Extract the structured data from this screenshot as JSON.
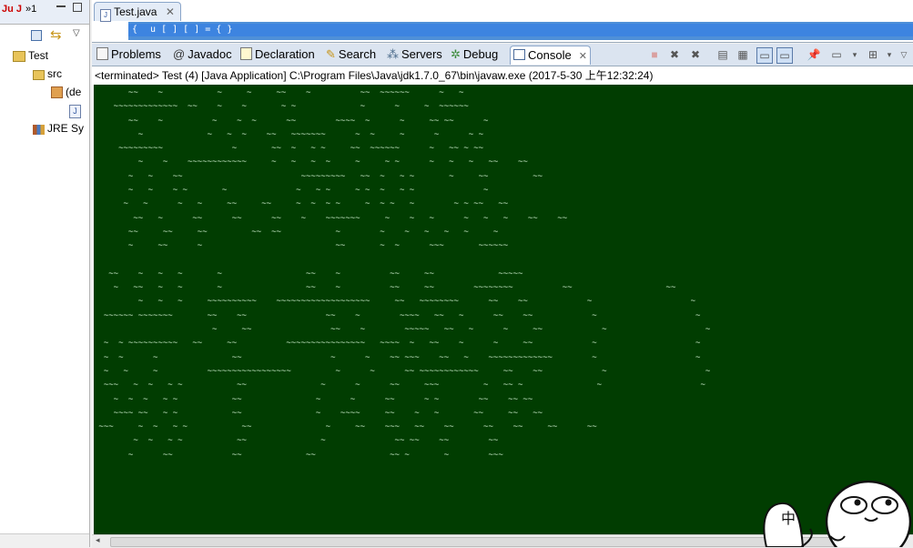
{
  "left_panel": {
    "tabs": [
      "Ju J",
      "»1"
    ],
    "tree": [
      {
        "label": "Test"
      },
      {
        "label": "src"
      },
      {
        "label": "(de"
      },
      {
        "label": "J"
      },
      {
        "label": "JRE Sy"
      }
    ]
  },
  "editor": {
    "tab_label": "Test.java",
    "line1": "{",
    "line2": "  u  [  ]  [  ]  =  {  }"
  },
  "view_tabs": [
    {
      "label": "Problems",
      "icon": "problems-icon"
    },
    {
      "label": "Javadoc",
      "icon": "at-icon"
    },
    {
      "label": "Declaration",
      "icon": "declaration-icon"
    },
    {
      "label": "Search",
      "icon": "search-icon"
    },
    {
      "label": "Servers",
      "icon": "servers-icon"
    },
    {
      "label": "Debug",
      "icon": "debug-icon"
    },
    {
      "label": "Console",
      "icon": "console-icon",
      "active": true
    }
  ],
  "console": {
    "header": "<terminated> Test (4) [Java Application] C:\\Program Files\\Java\\jdk1.7.0_67\\bin\\javaw.exe (2017-5-30 上午12:32:24)",
    "lines": [
      "       ~~    ~           ~     ~     ~~    ~          ~~  ~~~~~~      ~   ~",
      "    ~~~~~~~~~~~~~  ~~    ~    ~       ~ ~             ~      ~     ~  ~~~~~~",
      "       ~~    ~          ~    ~  ~      ~~        ~~~~  ~      ~     ~~ ~~      ~",
      "         ~             ~   ~  ~    ~~   ~~~~~~~      ~  ~     ~      ~      ~ ~",
      "     ~~~~~~~~~              ~       ~~  ~   ~ ~     ~~  ~~~~~~      ~   ~~ ~ ~~",
      "         ~    ~    ~~~~~~~~~~~~     ~   ~   ~  ~     ~     ~ ~      ~   ~   ~   ~~    ~~",
      "       ~   ~    ~~                        ~~~~~~~~~   ~~  ~   ~ ~       ~     ~~         ~~",
      "       ~   ~    ~ ~       ~              ~   ~ ~     ~ ~  ~   ~ ~              ~",
      "      ~   ~      ~   ~     ~~     ~~     ~  ~  ~ ~     ~  ~ ~   ~        ~ ~ ~~   ~~",
      "        ~~   ~      ~~      ~~      ~~    ~    ~~~~~~~     ~    ~   ~      ~   ~   ~    ~~    ~~",
      "       ~~     ~~     ~~         ~~  ~~           ~        ~    ~   ~   ~   ~     ~",
      "       ~     ~~      ~                           ~~       ~  ~      ~~~       ~~~~~~",
      "",
      "   ~~    ~   ~   ~       ~                 ~~    ~          ~~     ~~             ~~~~~",
      "    ~   ~~   ~   ~       ~                 ~~    ~          ~~     ~~        ~~~~~~~~          ~~                   ~~",
      "         ~   ~   ~     ~~~~~~~~~~    ~~~~~~~~~~~~~~~~~~~     ~~   ~~~~~~~~      ~~    ~~            ~                    ~",
      "  ~~~~~~ ~~~~~~~       ~~    ~~                ~~    ~        ~~~~   ~~   ~      ~~    ~~            ~                    ~",
      "                        ~     ~~                ~~    ~        ~~~~~   ~~   ~      ~     ~~            ~                    ~",
      "  ~  ~ ~~~~~~~~~~   ~~     ~~          ~~~~~~~~~~~~~~~~   ~~~~  ~   ~~    ~      ~     ~~            ~                    ~",
      "  ~  ~      ~               ~~                  ~      ~    ~~ ~~~    ~~   ~    ~~~~~~~~~~~~~        ~                    ~",
      "  ~   ~     ~          ~~~~~~~~~~~~~~~~~         ~      ~      ~~ ~~~~~~~~~~~~     ~~    ~~            ~                    ~",
      "  ~~~   ~  ~   ~ ~           ~~               ~      ~      ~~     ~~~         ~   ~~ ~               ~                    ~",
      "    ~  ~  ~   ~ ~           ~~               ~      ~      ~~      ~ ~        ~~    ~~ ~~",
      "    ~~~~ ~~   ~ ~           ~~               ~    ~~~~     ~~    ~   ~       ~~     ~~   ~~",
      " ~~~     ~  ~   ~ ~           ~~               ~     ~~    ~~~   ~~    ~~      ~~    ~~     ~~      ~~",
      "        ~  ~   ~ ~           ~~               ~              ~~ ~~    ~~        ~~",
      "       ~      ~~            ~~             ~~               ~~ ~       ~        ~~~"
    ]
  },
  "meme": {
    "text": "中"
  }
}
